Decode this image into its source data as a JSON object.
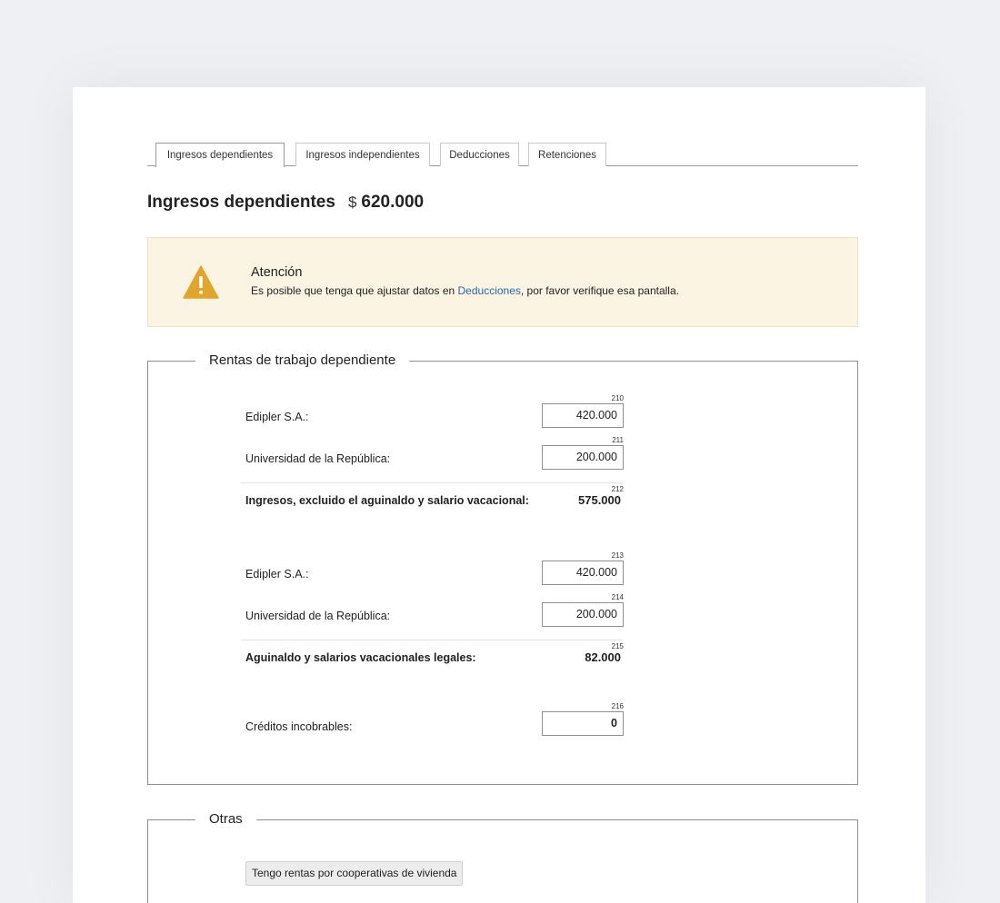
{
  "tabs": [
    {
      "label": "Ingresos dependientes",
      "active": true
    },
    {
      "label": "Ingresos independientes",
      "active": false
    },
    {
      "label": "Deducciones",
      "active": false
    },
    {
      "label": "Retenciones",
      "active": false
    }
  ],
  "heading": {
    "title": "Ingresos dependientes",
    "currency": "$",
    "amount": "620.000"
  },
  "alert": {
    "title": "Atención",
    "text_before": "Es posible que tenga que ajustar datos en ",
    "link": "Deducciones",
    "text_after": ", por favor verifique esa pantalla.",
    "icon": "warning-triangle-icon",
    "icon_color": "#e0a52c"
  },
  "rentas": {
    "legend": "Rentas de trabajo dependiente",
    "rows": [
      {
        "code": "210",
        "label": "Edipler S.A.:",
        "value": "420.000"
      },
      {
        "code": "211",
        "label": "Universidad de la República:",
        "value": "200.000"
      },
      {
        "code": "212",
        "label": "Ingresos, excluido el aguinaldo y salario vacacional:",
        "value": "575.000"
      },
      {
        "code": "213",
        "label": "Edipler S.A.:",
        "value": "420.000"
      },
      {
        "code": "214",
        "label": "Universidad de la República:",
        "value": "200.000"
      },
      {
        "code": "215",
        "label": "Aguinaldo y salarios vacacionales legales:",
        "value": "82.000"
      },
      {
        "code": "216",
        "label": "Créditos incobrables:",
        "value": "0"
      }
    ]
  },
  "otras": {
    "legend": "Otras",
    "button": "Tengo rentas por cooperativas de vivienda"
  },
  "colors": {
    "link": "#2767a8",
    "alert_bg": "#fbf4e3",
    "page_bg": "#eef0f3"
  }
}
